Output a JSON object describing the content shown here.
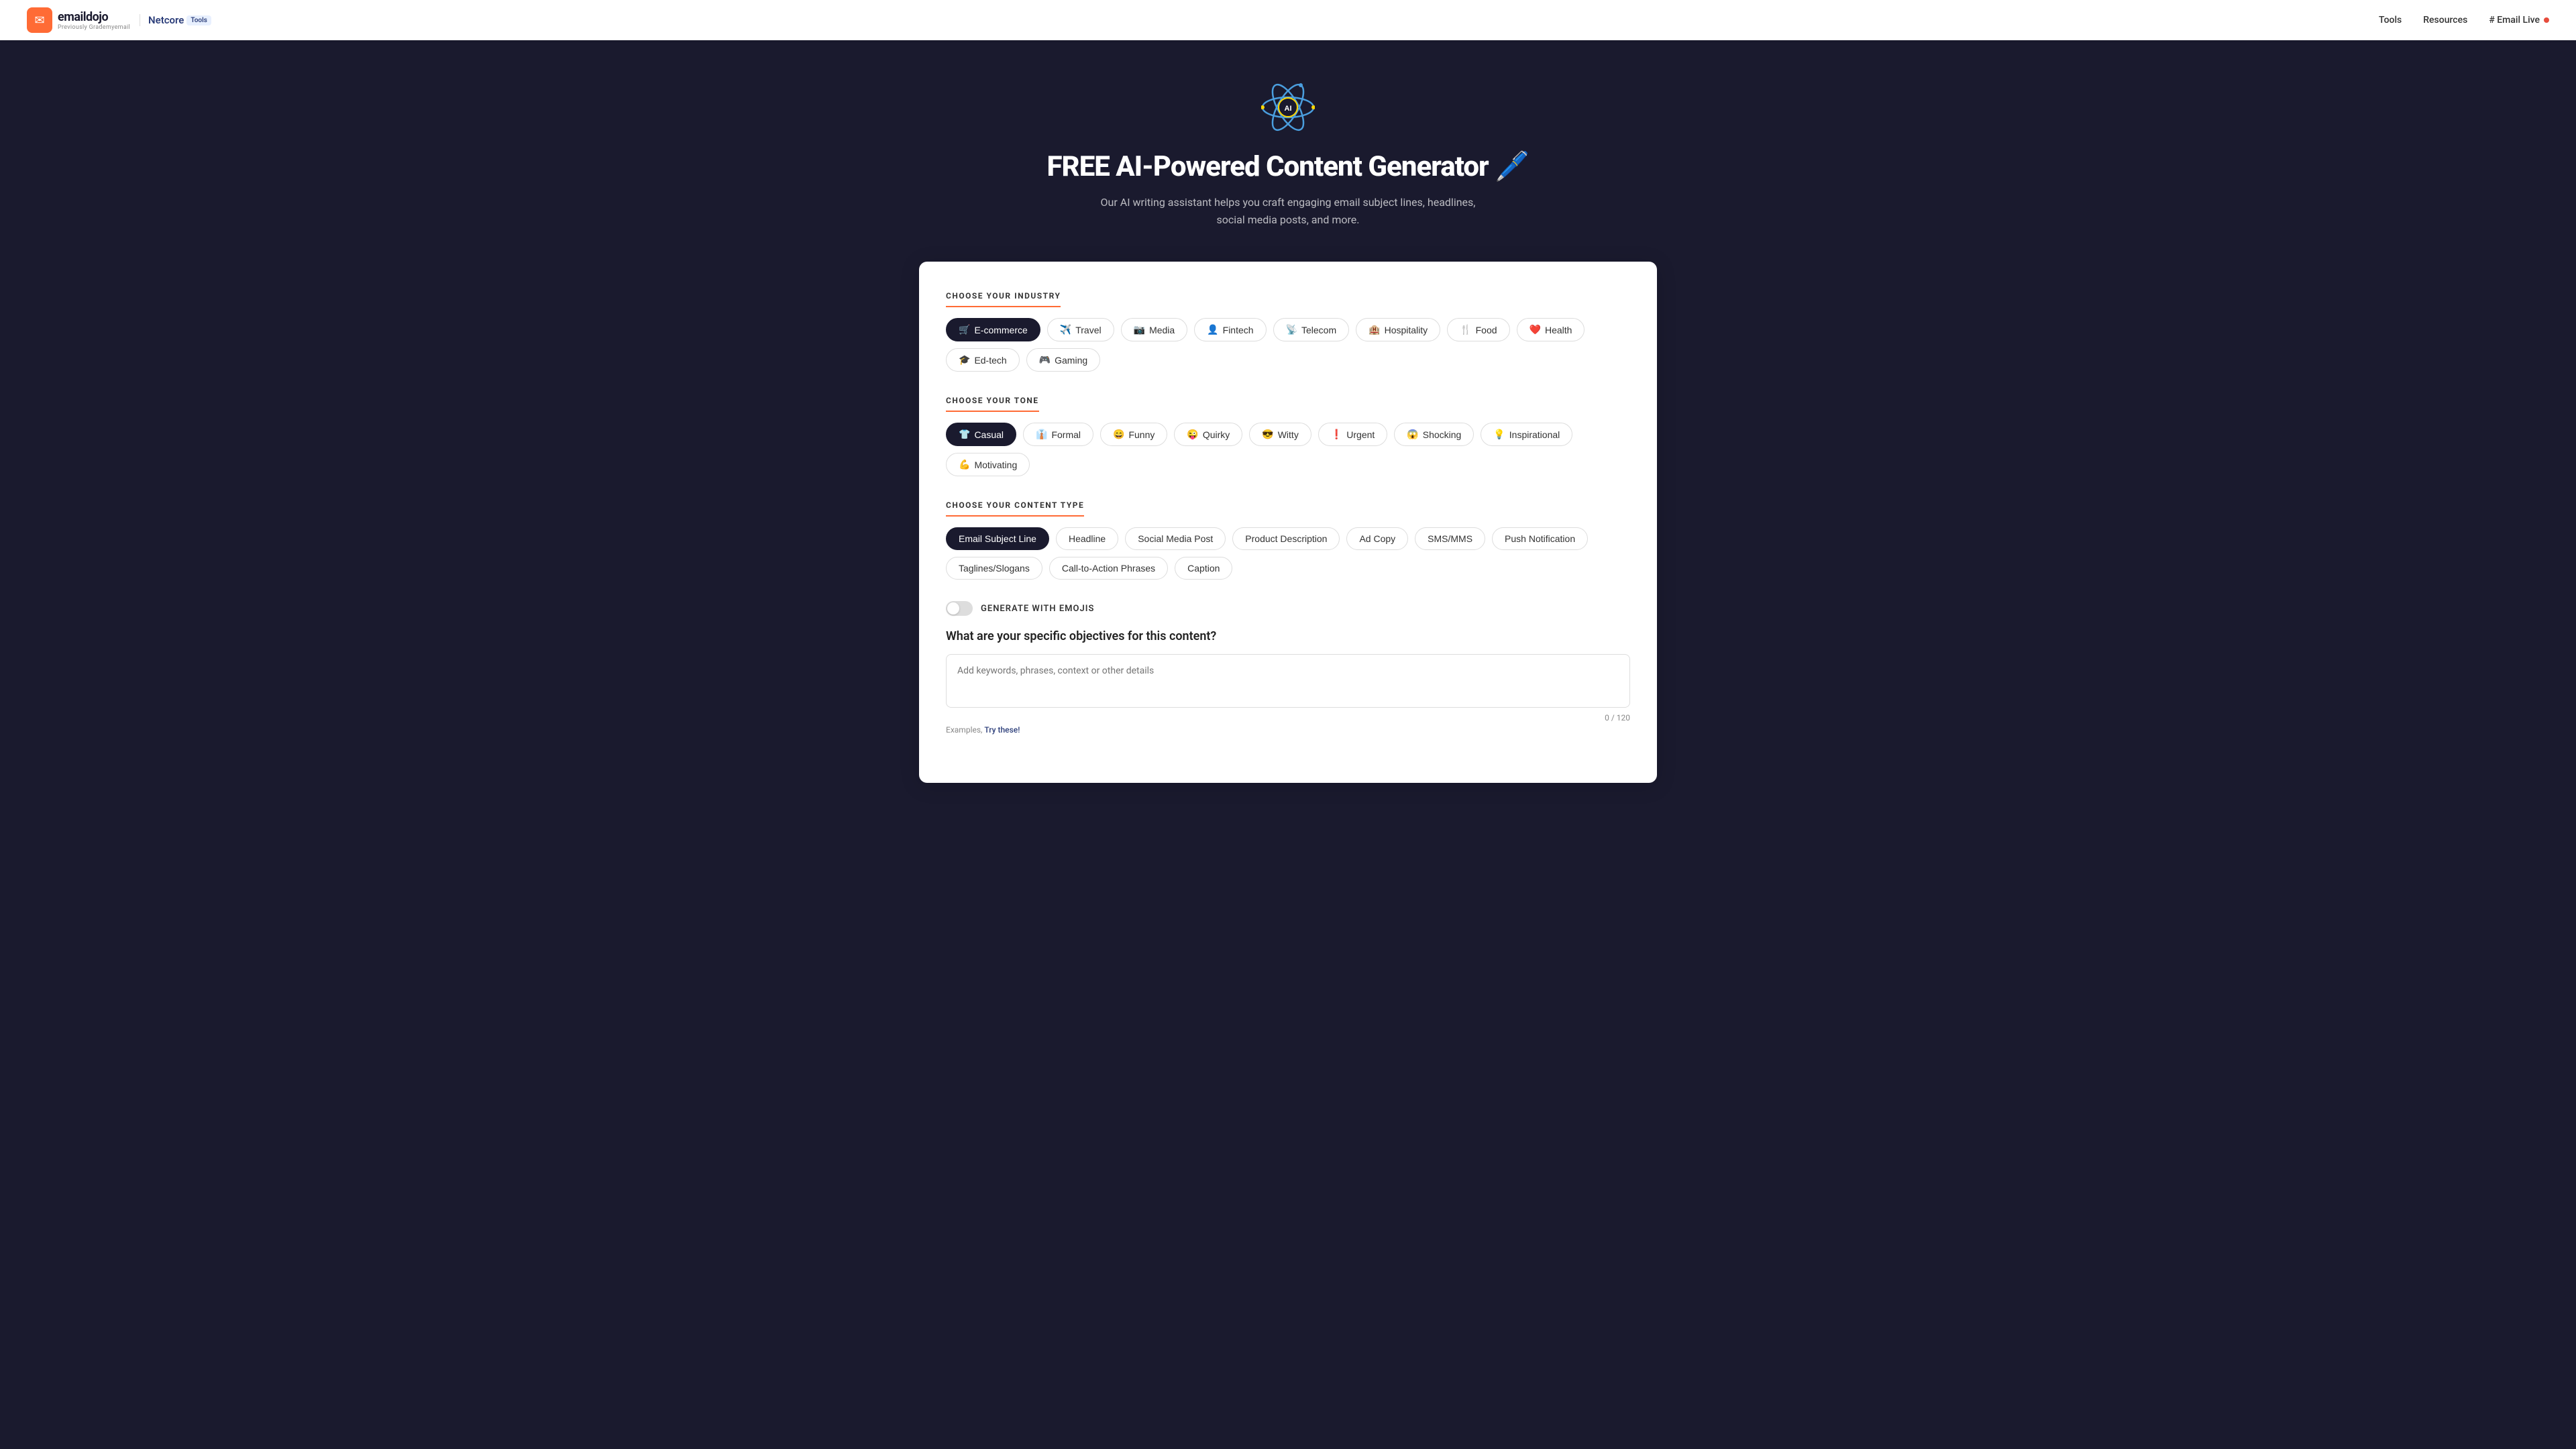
{
  "navbar": {
    "logo_icon": "✉",
    "logo_main": "emaildojo",
    "logo_sub": "Previously Grademyemail",
    "netcore_text": "Netcore",
    "tools_badge": "Tools",
    "nav_items": [
      "Tools",
      "Resources"
    ],
    "email_live_label": "# Email Live"
  },
  "hero": {
    "title": "FREE AI-Powered Content Generator 🖊️",
    "subtitle": "Our AI writing assistant helps you craft engaging email subject lines, headlines, social media posts, and more."
  },
  "choose_industry": {
    "section_title": "CHOOSE YOUR INDUSTRY",
    "items": [
      {
        "label": "E-commerce",
        "icon": "🛒",
        "active": true
      },
      {
        "label": "Travel",
        "icon": "✈️",
        "active": false
      },
      {
        "label": "Media",
        "icon": "📷",
        "active": false
      },
      {
        "label": "Fintech",
        "icon": "👤",
        "active": false
      },
      {
        "label": "Telecom",
        "icon": "📡",
        "active": false
      },
      {
        "label": "Hospitality",
        "icon": "🏨",
        "active": false
      },
      {
        "label": "Food",
        "icon": "🍴",
        "active": false
      },
      {
        "label": "Health",
        "icon": "❤️",
        "active": false
      },
      {
        "label": "Ed-tech",
        "icon": "🎓",
        "active": false
      },
      {
        "label": "Gaming",
        "icon": "🎮",
        "active": false
      }
    ]
  },
  "choose_tone": {
    "section_title": "CHOOSE YOUR TONE",
    "items": [
      {
        "label": "Casual",
        "icon": "👕",
        "active": true
      },
      {
        "label": "Formal",
        "icon": "👔",
        "active": false
      },
      {
        "label": "Funny",
        "icon": "😄",
        "active": false
      },
      {
        "label": "Quirky",
        "icon": "😜",
        "active": false
      },
      {
        "label": "Witty",
        "icon": "😎",
        "active": false
      },
      {
        "label": "Urgent",
        "icon": "❗",
        "active": false
      },
      {
        "label": "Shocking",
        "icon": "😱",
        "active": false
      },
      {
        "label": "Inspirational",
        "icon": "💡",
        "active": false
      },
      {
        "label": "Motivating",
        "icon": "💪",
        "active": false
      }
    ]
  },
  "choose_content_type": {
    "section_title": "CHOOSE YOUR CONTENT TYPE",
    "items": [
      {
        "label": "Email Subject Line",
        "active": true
      },
      {
        "label": "Headline",
        "active": false
      },
      {
        "label": "Social Media Post",
        "active": false
      },
      {
        "label": "Product Description",
        "active": false
      },
      {
        "label": "Ad Copy",
        "active": false
      },
      {
        "label": "SMS/MMS",
        "active": false
      },
      {
        "label": "Push Notification",
        "active": false
      },
      {
        "label": "Taglines/Slogans",
        "active": false
      },
      {
        "label": "Call-to-Action Phrases",
        "active": false
      },
      {
        "label": "Caption",
        "active": false
      }
    ]
  },
  "emojis_toggle": {
    "label": "GENERATE WITH EMOJIS"
  },
  "objectives": {
    "title": "What are your specific objectives for this content?",
    "placeholder": "Add keywords, phrases, context or other details",
    "char_count": "0 / 120",
    "examples_text": "Examples,",
    "try_these_label": "Try these!"
  }
}
